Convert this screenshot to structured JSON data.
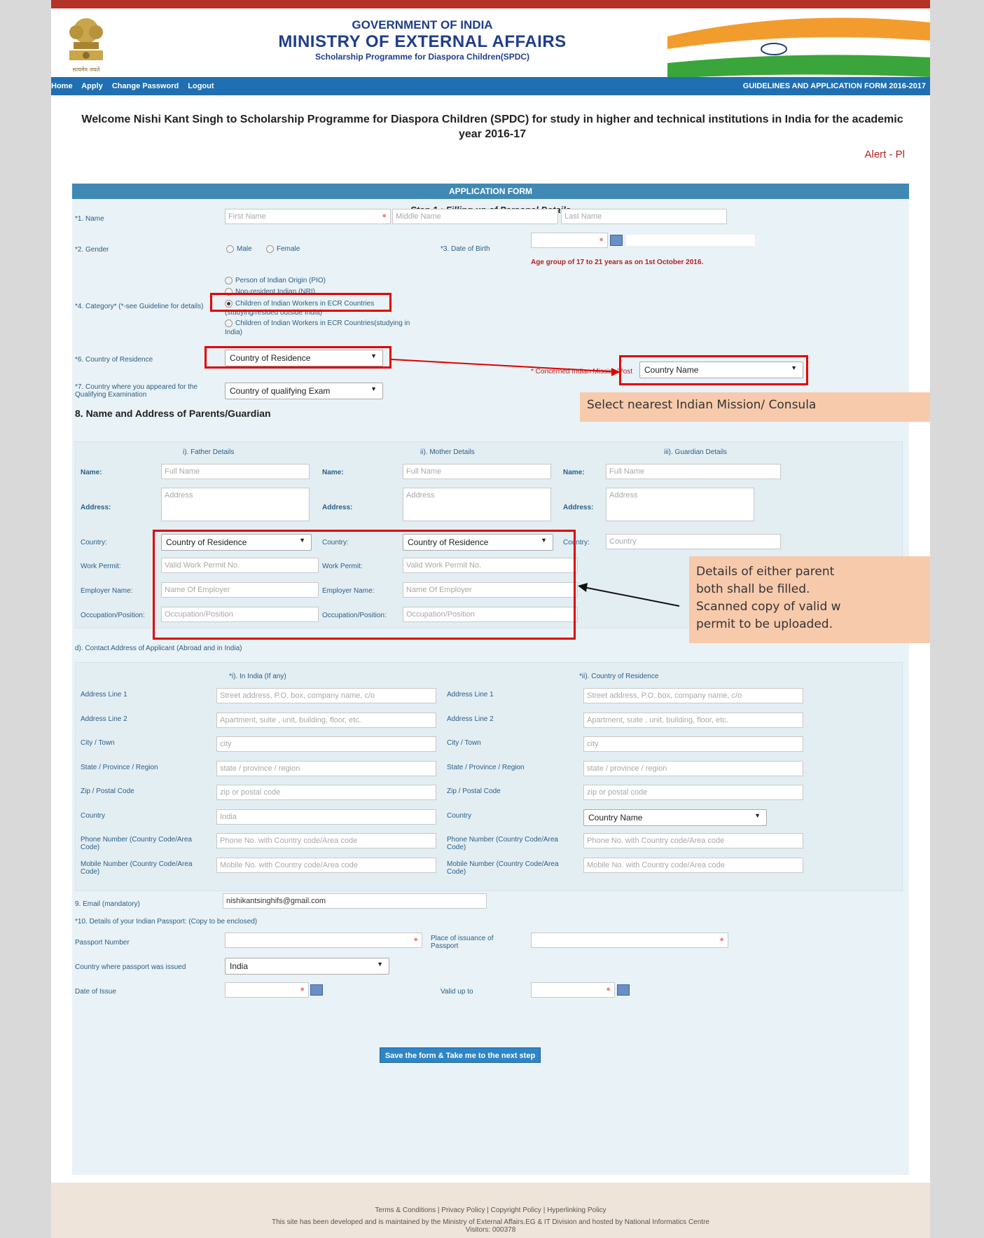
{
  "header": {
    "line1": "GOVERNMENT OF INDIA",
    "line2": "MINISTRY OF EXTERNAL AFFAIRS",
    "line3": "Scholarship Programme for Diaspora Children(SPDC)",
    "emblem_text": "सत्यमेव जयते"
  },
  "nav": {
    "items": [
      "Home",
      "Apply",
      "Change Password",
      "Logout"
    ],
    "right": "GUIDELINES AND APPLICATION FORM 2016-2017"
  },
  "welcome": "Welcome Nishi Kant Singh to Scholarship Programme for Diaspora Children (SPDC) for study in higher and technical institutions in India for the academic year 2016-17",
  "alert": "Alert - Pl",
  "form": {
    "header": "APPLICATION FORM",
    "step": "Step 1 : Filling up of Personal Details",
    "name_label": "*1. Name",
    "first_name_ph": "First Name",
    "middle_name_ph": "Middle Name",
    "last_name_ph": "Last Name",
    "gender_label": "*2. Gender",
    "male": "Male",
    "female": "Female",
    "dob_label": "*3. Date of Birth",
    "age_note": "Age group of 17 to 21 years as on 1st October 2016.",
    "category_label": "*4. Category* (*-see Guideline for details)",
    "category_options": [
      "Person of Indian Origin (PIO)",
      "Non-resident Indian (NRI)",
      "Children of Indian Workers in ECR Countries",
      "(studying/resided outside India)",
      "Children of Indian Workers in ECR Countries(studying in India)"
    ],
    "country_res_label": "*6. Country of Residence",
    "country_res_value": "Country of Residence",
    "mission_label": "* Concerned Indian Mission/Post",
    "mission_value": "Country Name",
    "qual_label": "*7. Country where you appeared for the Qualifying Examination",
    "qual_value": "Country of qualifying Exam",
    "section8": "8. Name and Address of Parents/Guardian",
    "father_head": "i). Father Details",
    "mother_head": "ii). Mother Details",
    "guardian_head": "iii). Guardian Details",
    "name": "Name:",
    "address": "Address:",
    "country": "Country:",
    "work_permit": "Work Permit:",
    "employer": "Employer Name:",
    "occupation": "Occupation/Position:",
    "full_name_ph": "Full Name",
    "address_ph": "Address",
    "country_ph": "Country",
    "work_permit_ph": "Valid Work Permit No.",
    "employer_ph": "Name Of Employer",
    "occupation_ph": "Occupation/Position",
    "contact_title": "d). Contact Address of Applicant (Abroad and in India)",
    "india_head": "*i). In India (If any)",
    "residence_head": "*ii). Country of Residence",
    "addr_rows": [
      {
        "label": "Address Line 1",
        "ph": "Street address, P.O. box, company name, c/o"
      },
      {
        "label": "Address Line 2",
        "ph": "Apartment, suite , unit, building, floor, etc."
      },
      {
        "label": "City / Town",
        "ph": "city"
      },
      {
        "label": "State / Province / Region",
        "ph": "state / province / region"
      },
      {
        "label": "Zip / Postal Code",
        "ph": "zip or postal code"
      },
      {
        "label": "Country",
        "ph": "India"
      },
      {
        "label": "Phone Number (Country Code/Area Code)",
        "ph": "Phone No. with Country code/Area code"
      },
      {
        "label": "Mobile Number (Country Code/Area Code)",
        "ph": "Mobile No. with Country code/Area code"
      }
    ],
    "res_country_value": "Country Name",
    "email_label": "9. Email (mandatory)",
    "email_value": "nishikantsinghifs@gmail.com",
    "passport_title": "*10. Details of your Indian Passport: (Copy to be enclosed)",
    "passport_no": "Passport Number",
    "place_issue": "Place of issuance of Passport",
    "country_issued": "Country where passport was issued",
    "country_issued_value": "India",
    "date_issue": "Date of Issue",
    "valid_upto": "Valid up to",
    "save_button": "Save the form & Take me to the next step"
  },
  "callouts": {
    "mission": "Select nearest Indian Mission/ Consula",
    "parents_line1": "Details of either parent",
    "parents_line2": "both shall be filled.",
    "parents_line3": "Scanned copy of valid w",
    "parents_line4": "permit to be uploaded."
  },
  "footer": {
    "links": "Terms & Conditions | Privacy Policy | Copyright Policy | Hyperlinking Policy",
    "credit": "This site has been developed and is maintained by the Ministry of External Affairs.EG & IT Division and hosted by National Informatics Centre",
    "visitors": "Visitors: 000378"
  },
  "colors": {
    "nav": "#1f6fb2",
    "form_header": "#3f89b4",
    "annotation": "#e00000",
    "callout": "#f7caac"
  }
}
